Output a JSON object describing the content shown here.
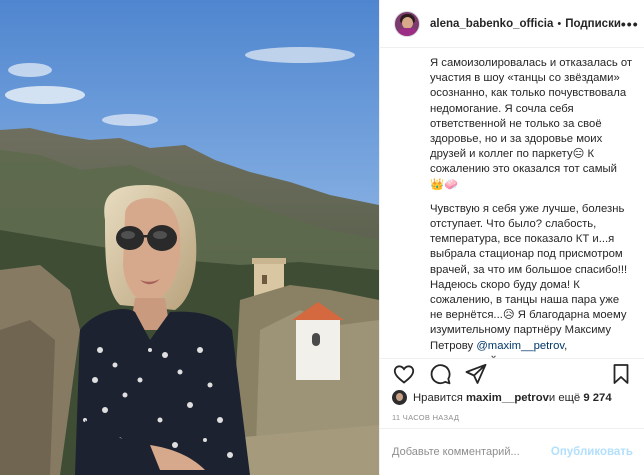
{
  "header": {
    "username": "alena_babenko_officia",
    "separator": "•",
    "follow_label": "Подписки",
    "more_label": "•••"
  },
  "caption": {
    "paragraph1": "Я самоизолировалась и отказалась от участия в шоу «танцы со звёздами» осознанно, как только почувствовала недомогание. Я сочла себя ответственной не только за своё здоровье, но и за здоровье моих друзей и коллег по паркету😑 К сожалению это оказался тот самый 👑🧼",
    "paragraph2_before": "Чувствую я себя уже лучше, болезнь отступает. Что было? слабость, температура, все показало КТ и...я выбрала стационар под присмотром врачей, за что им большое спасибо!!! Надеюсь скоро буду дома! К сожалению, в танцы наша пара уже не вернётся...😥 Я благодарна моему изумительному партнёру Максиму Петрову ",
    "mention": "@maxim__petrov",
    "paragraph2_after": ", талантливейшему"
  },
  "actions": {
    "like_icon": "heart-icon",
    "comment_icon": "comment-icon",
    "share_icon": "share-icon",
    "save_icon": "bookmark-icon"
  },
  "likes": {
    "prefix": "Нравится ",
    "user": "maxim__petrov",
    "middle": " и ещё ",
    "count": "9 274"
  },
  "timestamp": "11 ЧАСОВ НАЗАД",
  "comment_box": {
    "placeholder": "Добавьте комментарий...",
    "publish_label": "Опубликовать"
  }
}
